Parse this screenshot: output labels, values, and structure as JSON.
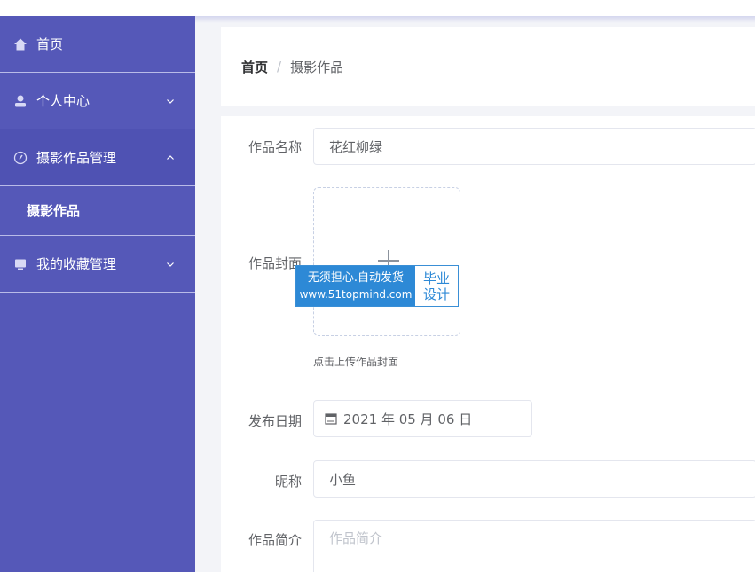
{
  "sidebar": {
    "items": [
      {
        "label": "首页",
        "icon": "home-icon"
      },
      {
        "label": "个人中心",
        "icon": "user-icon"
      },
      {
        "label": "摄影作品管理",
        "icon": "compass-icon"
      },
      {
        "label": "摄影作品"
      },
      {
        "label": "我的收藏管理",
        "icon": "monitor-icon"
      }
    ]
  },
  "breadcrumb": {
    "home": "首页",
    "separator": "/",
    "current": "摄影作品"
  },
  "form": {
    "name_label": "作品名称",
    "name_value": "花红柳绿",
    "cover_label": "作品封面",
    "cover_tip": "点击上传作品封面",
    "date_label": "发布日期",
    "date_value": "2021 年 05 月 06 日",
    "nickname_label": "昵称",
    "nickname_value": "小鱼",
    "intro_label": "作品简介",
    "intro_placeholder": "作品简介"
  },
  "watermark": {
    "line1": "无须担心.自动发货",
    "line2": "www.51topmind.com",
    "right1": "毕业",
    "right2": "设计"
  },
  "colors": {
    "sidebar": "#5558b8",
    "accent": "#2d89d6"
  }
}
